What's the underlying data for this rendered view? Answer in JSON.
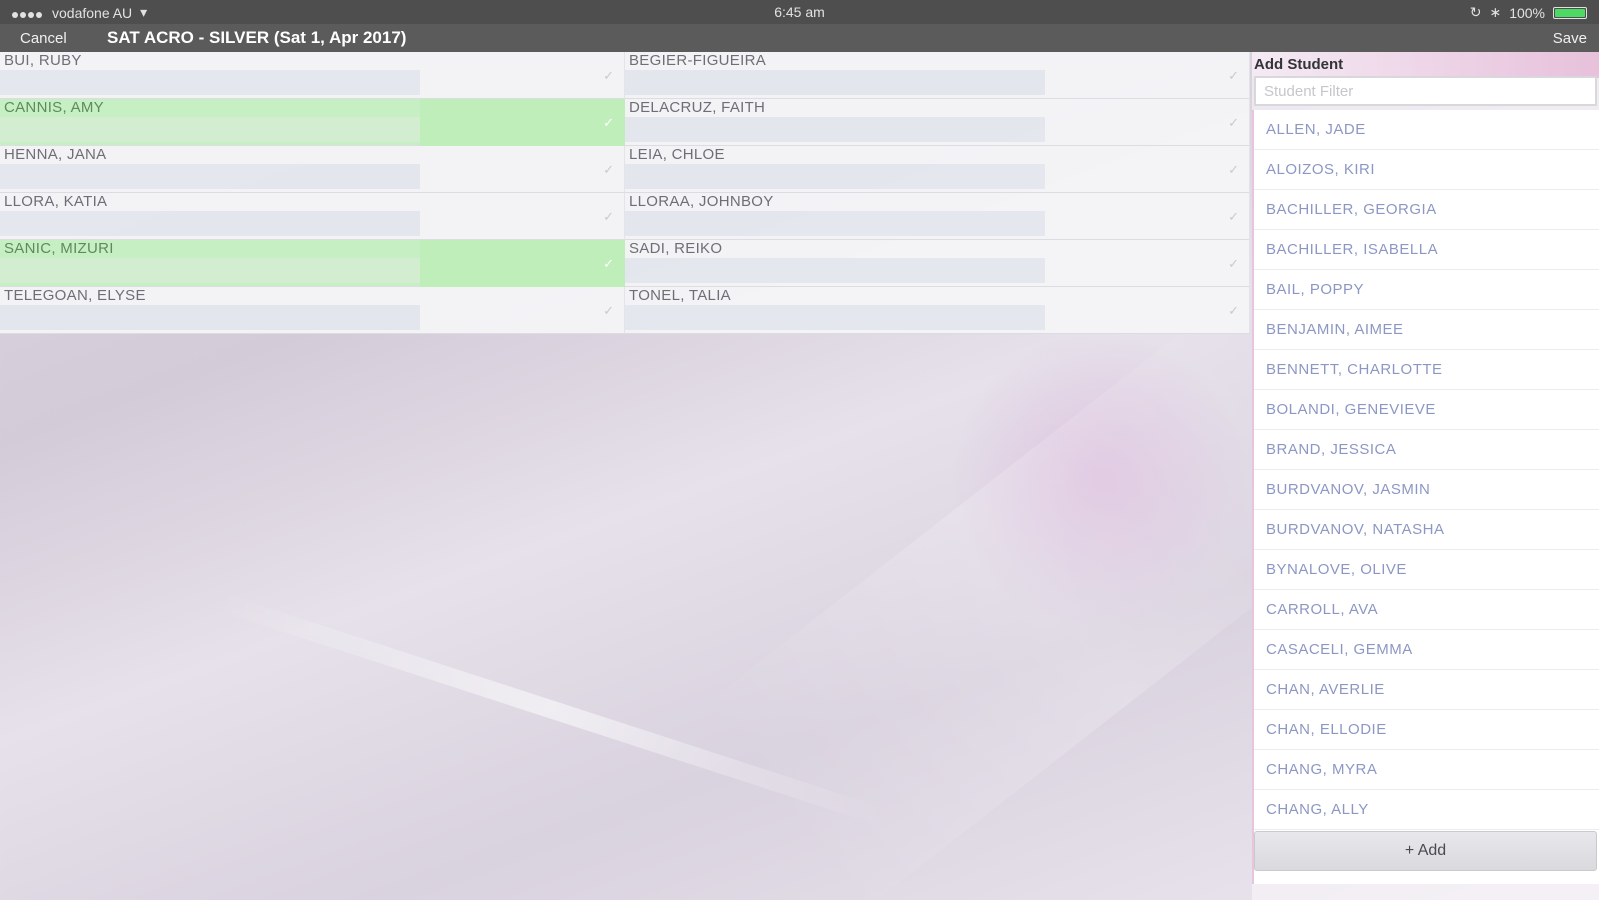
{
  "status_bar": {
    "carrier": "vodafone AU",
    "time": "6:45 am",
    "battery_percent": "100%",
    "battery_level": 1.0
  },
  "nav": {
    "cancel_label": "Cancel",
    "title": "SAT ACRO - SILVER (Sat 1, Apr 2017)",
    "save_label": "Save"
  },
  "students_grid": [
    {
      "name": "BUI, RUBY",
      "present": false
    },
    {
      "name": "BEGIER-FIGUEIRA",
      "present": false
    },
    {
      "name": "CANNIS, AMY",
      "present": true
    },
    {
      "name": "DELACRUZ, FAITH",
      "present": false
    },
    {
      "name": "HENNA, JANA",
      "present": false
    },
    {
      "name": "LEIA, CHLOE",
      "present": false
    },
    {
      "name": "LLORA, KATIA",
      "present": false
    },
    {
      "name": "LLORAA, JOHNBOY",
      "present": false
    },
    {
      "name": "SANIC, MIZURI",
      "present": true
    },
    {
      "name": "SADI, REIKO",
      "present": false
    },
    {
      "name": "TELEGOAN, ELYSE",
      "present": false
    },
    {
      "name": "TONEL, TALIA",
      "present": false
    }
  ],
  "add_student": {
    "title": "Add Student",
    "filter_placeholder": "Student Filter",
    "add_label": "+ Add",
    "students": [
      "ALLEN, JADE",
      "ALOIZOS, KIRI",
      "BACHILLER, GEORGIA",
      "BACHILLER, ISABELLA",
      "BAIL, POPPY",
      "BENJAMIN, AIMEE",
      "BENNETT, CHARLOTTE",
      "BOLANDI, GENEVIEVE",
      "BRAND, JESSICA",
      "BURDVANOV, JASMIN",
      "BURDVANOV, NATASHA",
      "BYNALOVE, OLIVE",
      "CARROLL, AVA",
      "CASACELI, GEMMA",
      "CHAN, AVERLIE",
      "CHAN, ELLODIE",
      "CHANG, MYRA",
      "CHANG, ALLY"
    ]
  },
  "colors": {
    "present_row": "#c6efc3",
    "nav_bar": "#5b5b5b",
    "student_list_text": "#8d97c4"
  }
}
